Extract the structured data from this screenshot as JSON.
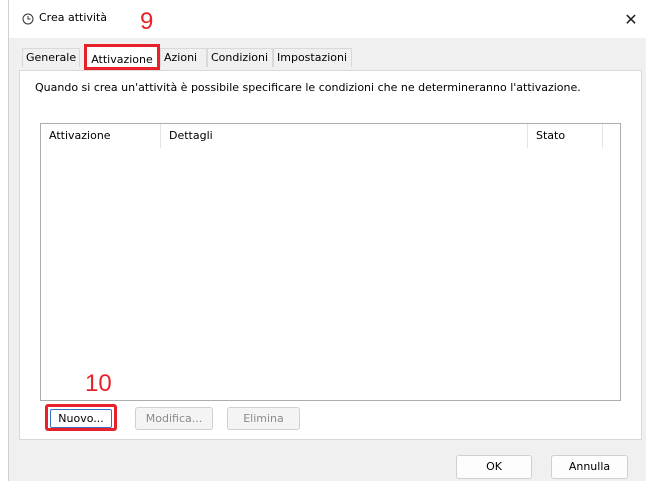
{
  "window": {
    "title": "Crea attività",
    "close_symbol": "✕"
  },
  "annotations": {
    "step9": "9",
    "step10": "10"
  },
  "tabs": [
    {
      "label": "Generale"
    },
    {
      "label": "Attivazione"
    },
    {
      "label": "Azioni"
    },
    {
      "label": "Condizioni"
    },
    {
      "label": "Impostazioni"
    }
  ],
  "panel": {
    "description": "Quando si crea un'attività è possibile specificare le condizioni che ne determineranno l'attivazione.",
    "columns": [
      "Attivazione",
      "Dettagli",
      "Stato"
    ]
  },
  "buttons": {
    "new": "Nuovo...",
    "edit": "Modifica...",
    "delete": "Elimina",
    "ok": "OK",
    "cancel": "Annulla"
  },
  "colors": {
    "annotation": "#e8222a",
    "focus": "#3a6fc4"
  },
  "icons": {
    "title": "clock-icon",
    "close": "close-icon"
  }
}
